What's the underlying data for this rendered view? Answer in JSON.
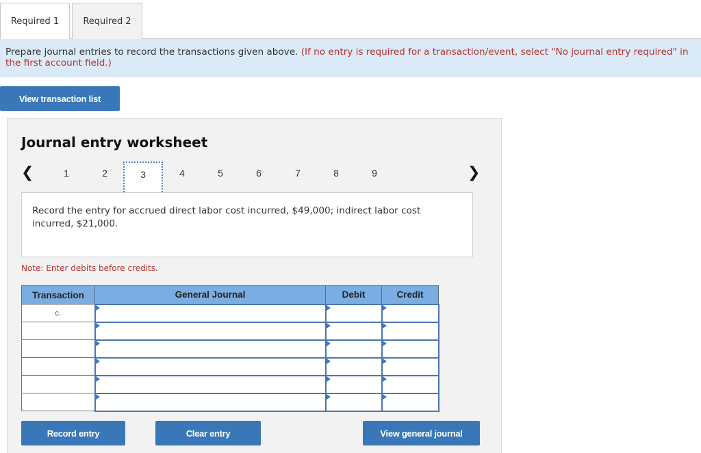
{
  "tabs": [
    {
      "label": "Required 1",
      "active": true
    },
    {
      "label": "Required 2",
      "active": false
    }
  ],
  "banner": {
    "instruction": "Prepare journal entries to record the transactions given above.",
    "hint": "(If no entry is required for a transaction/event, select \"No journal entry required\" in the first account field.)"
  },
  "buttons": {
    "view_transaction_list": "View transaction list",
    "record_entry": "Record entry",
    "clear_entry": "Clear entry",
    "view_general_journal": "View general journal"
  },
  "worksheet": {
    "title": "Journal entry worksheet",
    "pager": {
      "prev_icon": "‹",
      "next_icon": "›",
      "pages": [
        "1",
        "2",
        "3",
        "4",
        "5",
        "6",
        "7",
        "8",
        "9"
      ],
      "current": "3"
    },
    "prompt": "Record the entry for accrued direct labor cost incurred, $49,000; indirect labor cost incurred, $21,000.",
    "note": "Note: Enter debits before credits.",
    "table": {
      "headers": [
        "Transaction",
        "General Journal",
        "Debit",
        "Credit"
      ],
      "rows": [
        {
          "transaction": "c.",
          "account": "",
          "debit": "",
          "credit": ""
        },
        {
          "transaction": "",
          "account": "",
          "debit": "",
          "credit": ""
        },
        {
          "transaction": "",
          "account": "",
          "debit": "",
          "credit": ""
        },
        {
          "transaction": "",
          "account": "",
          "debit": "",
          "credit": ""
        },
        {
          "transaction": "",
          "account": "",
          "debit": "",
          "credit": ""
        },
        {
          "transaction": "",
          "account": "",
          "debit": "",
          "credit": ""
        }
      ]
    }
  }
}
